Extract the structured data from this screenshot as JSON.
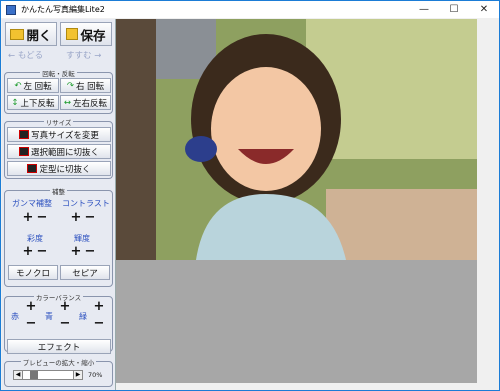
{
  "window": {
    "title": "かんたん写真編集Lite2",
    "minimize": "—",
    "maximize": "☐",
    "close": "✕"
  },
  "toolbar": {
    "open": "開く",
    "save": "保存",
    "back": "← もどる",
    "forward": "すすむ →"
  },
  "rotate": {
    "group": "回転・反転",
    "left": "左 回転",
    "right": "右 回転",
    "vflip": "上下反転",
    "hflip": "左右反転"
  },
  "resize": {
    "group": "リサイズ",
    "change": "写真サイズを変更",
    "crop_sel": "選択範囲に切抜く",
    "crop_shape": "定型に切抜く"
  },
  "adjust": {
    "group": "補整",
    "gamma": "ガンマ補整",
    "contrast": "コントラスト",
    "saturation": "彩度",
    "brightness": "輝度",
    "mono": "モノクロ",
    "sepia": "セピア"
  },
  "color": {
    "group": "カラーバランス",
    "red": "赤",
    "blue": "青",
    "green": "緑"
  },
  "effect": "エフェクト",
  "zoom": {
    "group": "プレビューの拡大・縮小",
    "value": "70%",
    "slider": 0.15
  },
  "pm": {
    "plus": "+",
    "minus": "−"
  }
}
